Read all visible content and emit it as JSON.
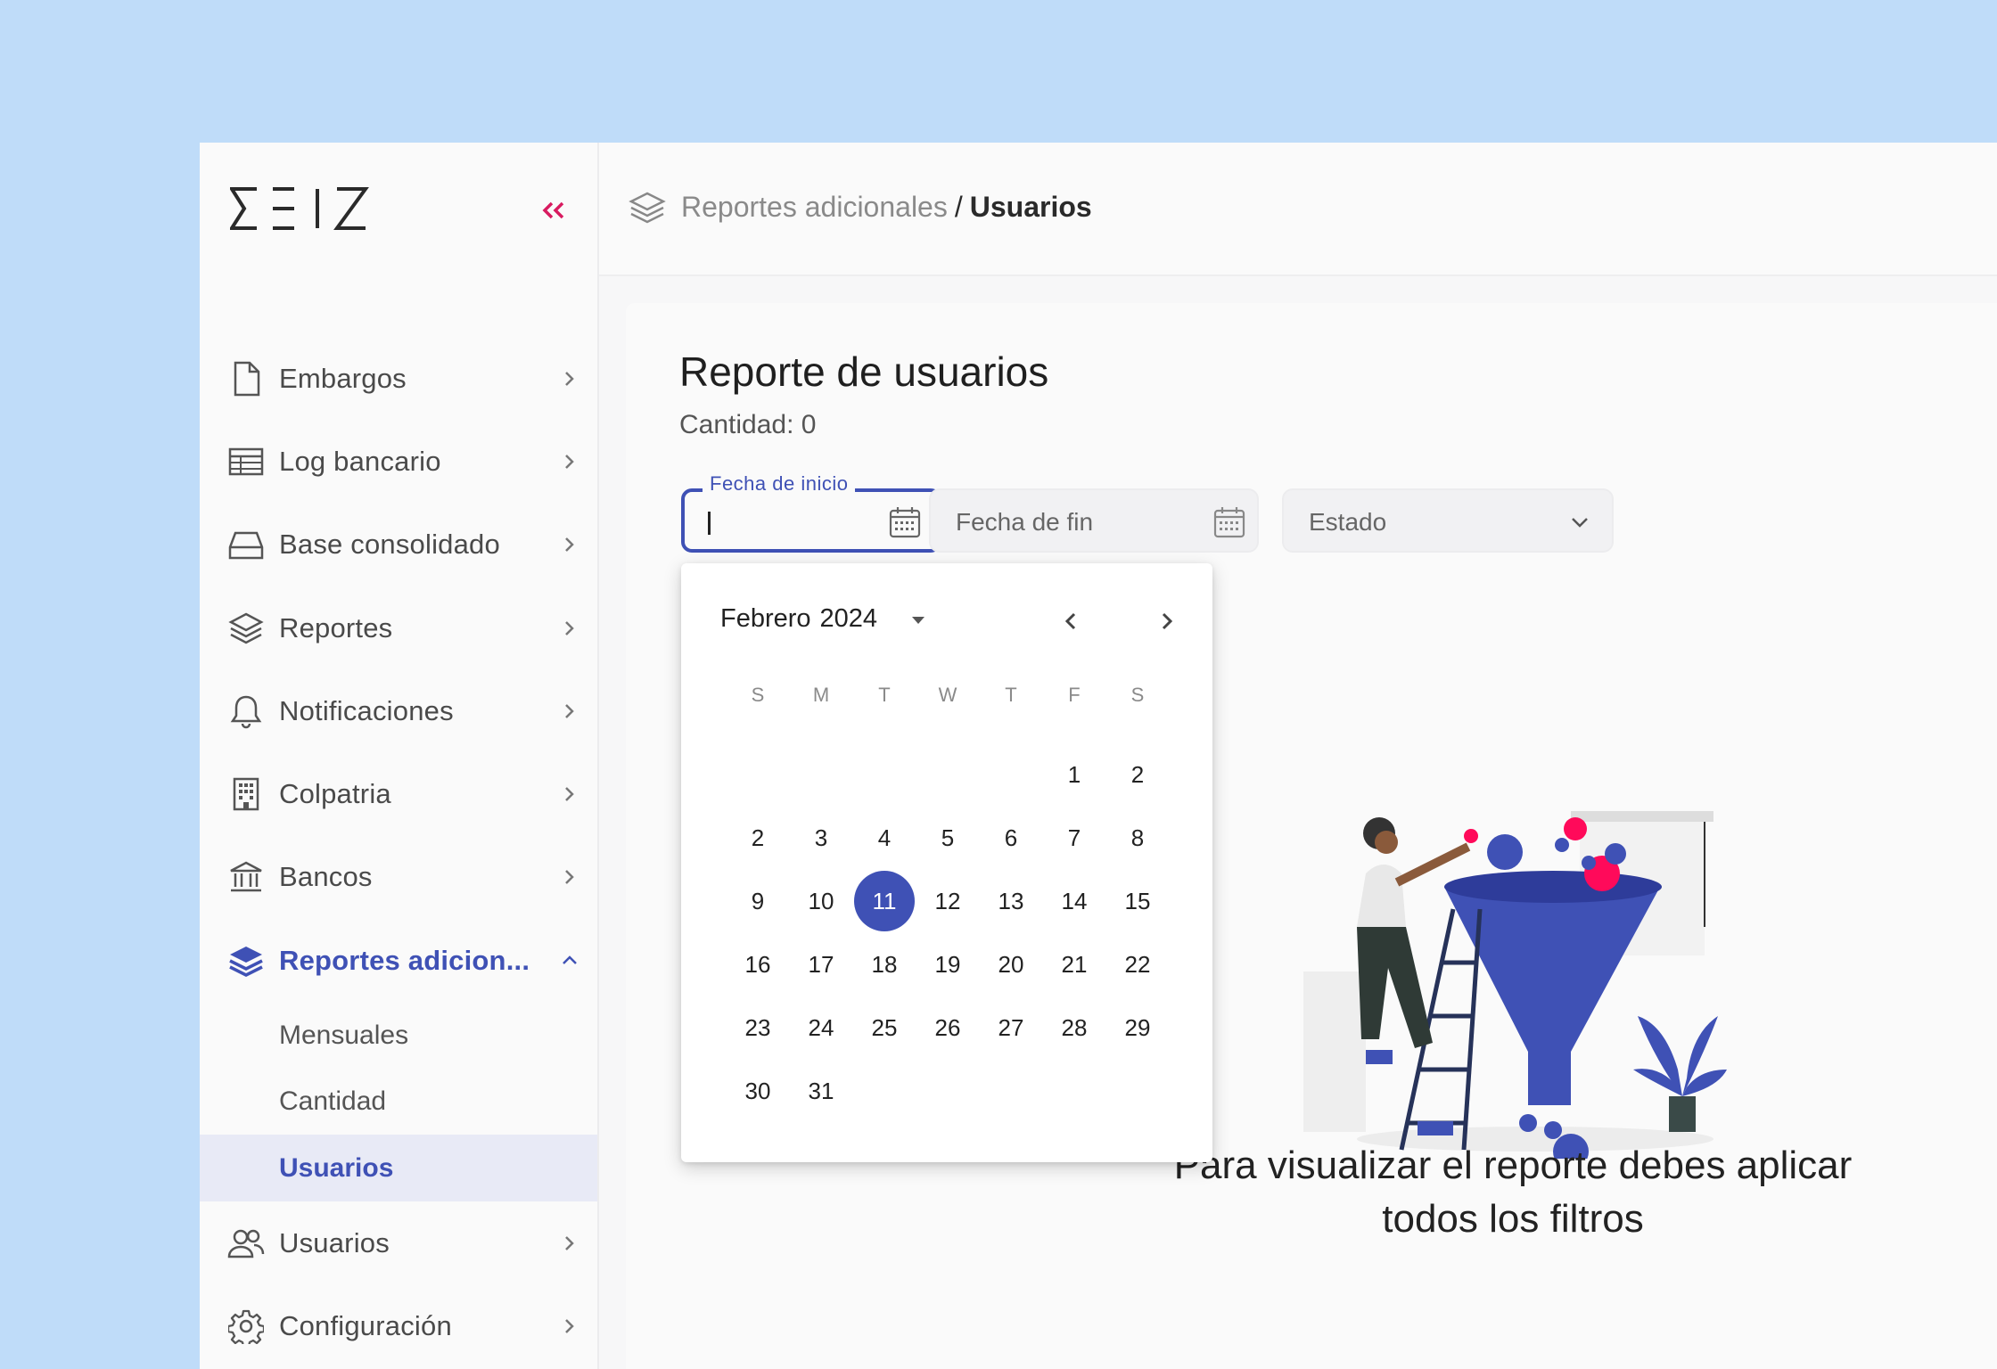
{
  "brand": {
    "logo_text": "SEIZ",
    "accent": "#3f51b5",
    "collapse_color": "#d81b60"
  },
  "sidebar": {
    "items": [
      {
        "label": "Embargos",
        "icon": "file-icon"
      },
      {
        "label": "Log bancario",
        "icon": "table-icon"
      },
      {
        "label": "Base consolidado",
        "icon": "hard-drive-icon"
      },
      {
        "label": "Reportes",
        "icon": "layers-icon"
      },
      {
        "label": "Notificaciones",
        "icon": "bell-icon"
      },
      {
        "label": "Colpatria",
        "icon": "building-icon"
      },
      {
        "label": "Bancos",
        "icon": "bank-icon"
      },
      {
        "label": "Reportes adicion...",
        "icon": "layers-filled-icon",
        "expanded": true
      },
      {
        "label": "Usuarios",
        "icon": "users-icon"
      },
      {
        "label": "Configuración",
        "icon": "gear-icon"
      }
    ],
    "subitems": [
      {
        "label": "Mensuales"
      },
      {
        "label": "Cantidad"
      },
      {
        "label": "Usuarios",
        "selected": true
      }
    ]
  },
  "header": {
    "breadcrumb_parent": "Reportes adicionales",
    "breadcrumb_separator": "/",
    "breadcrumb_current": "Usuarios"
  },
  "main": {
    "title": "Reporte de usuarios",
    "count_label": "Cantidad: 0",
    "filters": {
      "start_label": "Fecha de inicio",
      "start_value": "",
      "end_placeholder": "Fecha de fin",
      "estado_placeholder": "Estado"
    },
    "empty_message_line1": "Para visualizar el reporte debes aplicar",
    "empty_message_line2": "todos los filtros"
  },
  "calendar": {
    "month": "Febrero",
    "year": "2024",
    "weekdays": [
      "S",
      "M",
      "T",
      "W",
      "T",
      "F",
      "S"
    ],
    "weeks": [
      [
        "",
        "",
        "",
        "",
        "",
        "1",
        "2"
      ],
      [
        "2",
        "3",
        "4",
        "5",
        "6",
        "7",
        "8"
      ],
      [
        "9",
        "10",
        "11",
        "12",
        "13",
        "14",
        "15"
      ],
      [
        "16",
        "17",
        "18",
        "19",
        "20",
        "21",
        "22"
      ],
      [
        "23",
        "24",
        "25",
        "26",
        "27",
        "28",
        "29"
      ],
      [
        "30",
        "31",
        "",
        "",
        "",
        "",
        ""
      ]
    ],
    "selected": "11"
  }
}
